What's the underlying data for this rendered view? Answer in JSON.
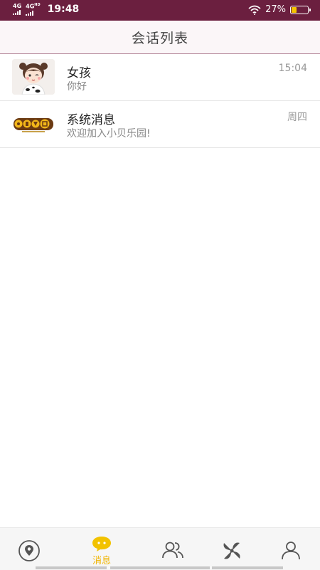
{
  "status_bar": {
    "network1": "4G",
    "network2": "4G",
    "network2_suffix": "HD",
    "time": "19:48",
    "battery": "27%",
    "battery_level": 0.27,
    "accent_color": "#6b1f3f"
  },
  "header": {
    "title": "会话列表"
  },
  "conversations": [
    {
      "name": "女孩",
      "last_message": "你好",
      "time": "15:04",
      "avatar_icon": "girl-avatar"
    },
    {
      "name": "系统消息",
      "last_message": "欢迎加入小贝乐园!",
      "time": "周四",
      "avatar_icon": "xiaobeileyuan-logo"
    }
  ],
  "bottom_nav": {
    "active_color": "#f0b400",
    "items": [
      {
        "icon": "location-pin-icon",
        "label": ""
      },
      {
        "icon": "chat-bubble-icon",
        "label": "消息",
        "active": true
      },
      {
        "icon": "contacts-icon",
        "label": ""
      },
      {
        "icon": "pinwheel-icon",
        "label": ""
      },
      {
        "icon": "profile-icon",
        "label": ""
      }
    ]
  }
}
